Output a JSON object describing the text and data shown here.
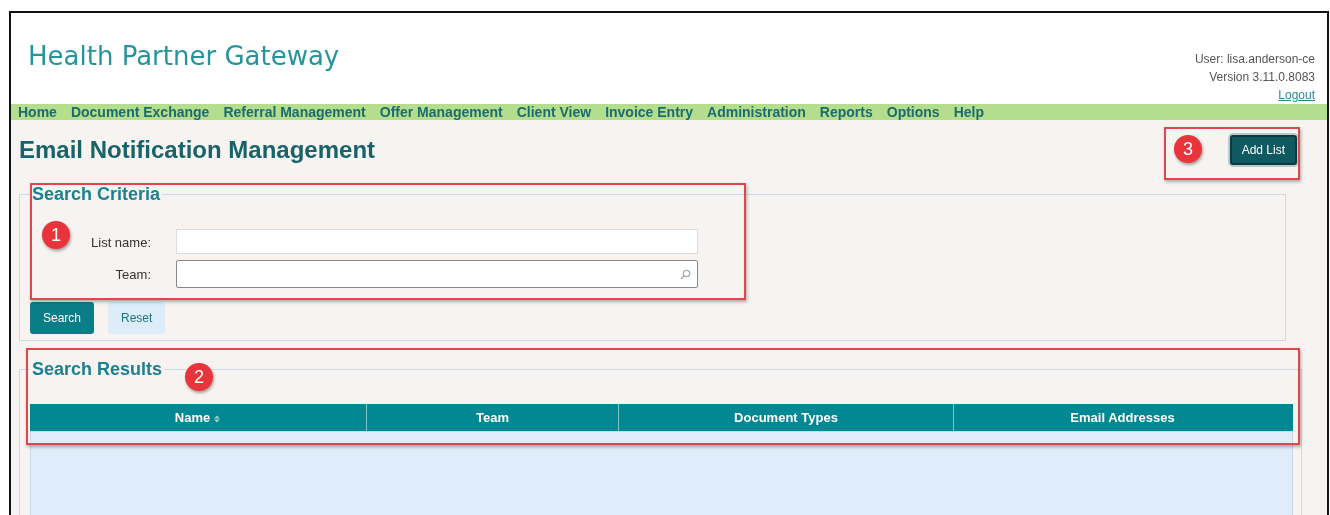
{
  "header": {
    "title": "Health Partner Gateway",
    "user": "User: lisa.anderson-ce",
    "version": "Version 3.11.0.8083",
    "logout": "Logout"
  },
  "nav": [
    "Home",
    "Document Exchange",
    "Referral Management",
    "Offer Management",
    "Client View",
    "Invoice Entry",
    "Administration",
    "Reports",
    "Options",
    "Help"
  ],
  "page_title": "Email Notification Management",
  "add_button": "Add List",
  "search_criteria": {
    "legend": "Search Criteria",
    "fields": [
      {
        "label": "List name:",
        "kind": "text"
      },
      {
        "label": "Team:",
        "kind": "lookup"
      }
    ],
    "buttons": [
      {
        "label": "Search",
        "kind": "primary"
      },
      {
        "label": "Reset",
        "kind": "secondary"
      }
    ]
  },
  "search_results": {
    "legend": "Search Results",
    "columns": [
      {
        "label": "Name",
        "sorted": true
      },
      {
        "label": "Team",
        "sorted": false
      },
      {
        "label": "Document Types",
        "sorted": false
      },
      {
        "label": "Email Addresses",
        "sorted": false
      }
    ]
  },
  "callouts": [
    "1",
    "2",
    "3"
  ]
}
